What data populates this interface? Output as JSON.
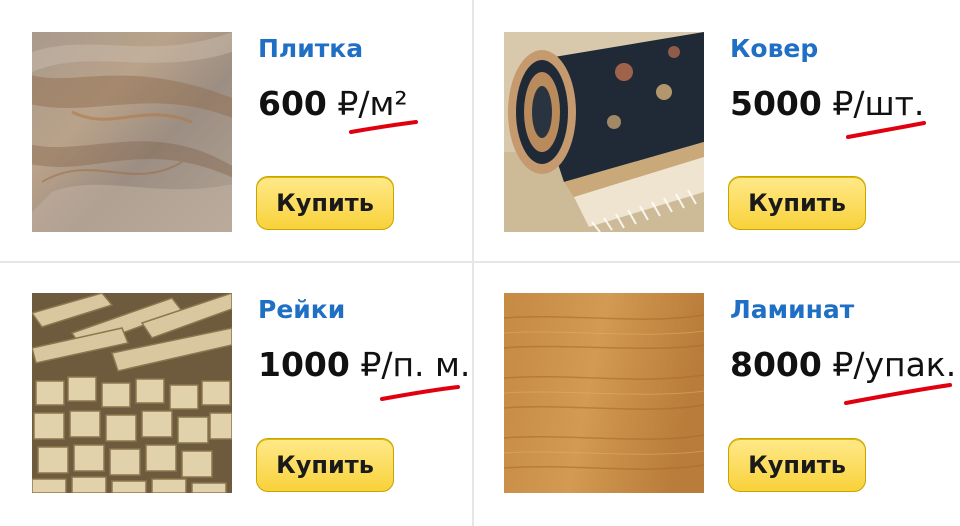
{
  "products": [
    {
      "name": "Плитка",
      "amount": "600",
      "unit": "₽/м²",
      "buy_label": "Купить",
      "image": "stone-tile"
    },
    {
      "name": "Ковер",
      "amount": "5000",
      "unit": "₽/шт.",
      "buy_label": "Купить",
      "image": "rolled-carpet"
    },
    {
      "name": "Рейки",
      "amount": "1000",
      "unit": "₽/п. м.",
      "buy_label": "Купить",
      "image": "wood-slats"
    },
    {
      "name": "Ламинат",
      "amount": "8000",
      "unit": "₽/упак.",
      "buy_label": "Купить",
      "image": "laminate-wood"
    }
  ],
  "colors": {
    "title": "#1f6fc4",
    "button": "#f8d23a",
    "underline": "#e0000f"
  }
}
